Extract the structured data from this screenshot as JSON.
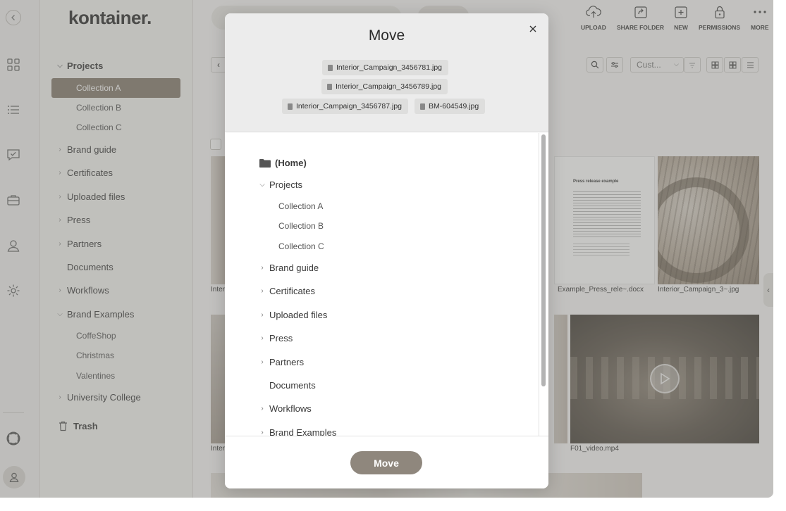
{
  "brand": {
    "logo_text": "kontainer."
  },
  "sidebar": {
    "projects": {
      "label": "Projects",
      "children": [
        "Collection A",
        "Collection B",
        "Collection C"
      ]
    },
    "folders": [
      "Brand guide",
      "Certificates",
      "Uploaded files",
      "Press",
      "Partners",
      "Documents",
      "Workflows"
    ],
    "brand_examples": {
      "label": "Brand Examples",
      "children": [
        "CoffeShop",
        "Christmas",
        "Valentines"
      ]
    },
    "university": "University College",
    "trash": "Trash"
  },
  "toolbar": {
    "actions": [
      {
        "label": "UPLOAD",
        "icon": "upload-cloud-icon"
      },
      {
        "label": "SHARE FOLDER",
        "icon": "share-icon"
      },
      {
        "label": "NEW",
        "icon": "new-folder-icon"
      },
      {
        "label": "PERMISSIONS",
        "icon": "lock-icon"
      },
      {
        "label": "MORE",
        "icon": "more-icon"
      }
    ],
    "sort_value": "Cust..."
  },
  "grid": {
    "captions": [
      "Inter",
      "Example_Press_rele~.docx",
      "Interior_Campaign_3~.jpg",
      "Inter",
      "F01_video.mp4"
    ],
    "press_doc": {
      "heading": "Press release example"
    }
  },
  "modal": {
    "title": "Move",
    "files": [
      "Interior_Campaign_3456781.jpg",
      "Interior_Campaign_3456789.jpg",
      "Interior_Campaign_3456787.jpg",
      "BM-604549.jpg"
    ],
    "home": "(Home)",
    "projects": {
      "label": "Projects",
      "children": [
        "Collection A",
        "Collection B",
        "Collection C"
      ]
    },
    "folders": [
      "Brand guide",
      "Certificates",
      "Uploaded files",
      "Press",
      "Partners",
      "Documents",
      "Workflows",
      "Brand Examples"
    ],
    "move_button": "Move"
  },
  "colors": {
    "accent": "#857a6d",
    "move_button": "#8f877d",
    "overlay": "rgba(120,118,115,0.42)"
  }
}
